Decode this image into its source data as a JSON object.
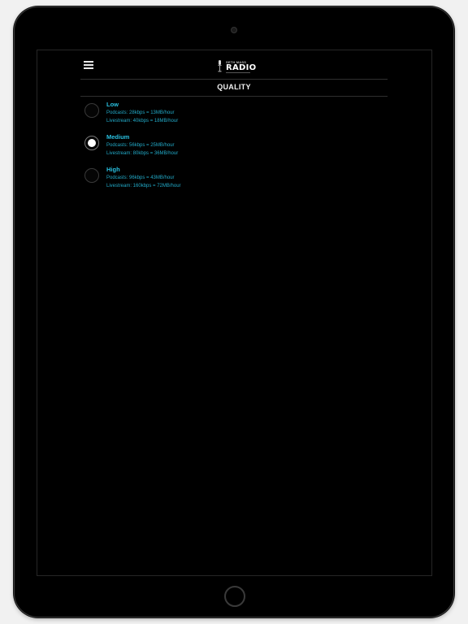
{
  "app": {
    "logo": {
      "small_text": "SETH MASS",
      "big_text": "RADIO"
    }
  },
  "header": {
    "title": "QUALITY",
    "menu_icon": "hamburger-menu-icon"
  },
  "quality_options": [
    {
      "label": "Low",
      "podcasts": "Podcasts: 28kbps = 13MB/hour",
      "livestream": "Livestream: 40kbps = 18MB/hour",
      "selected": false
    },
    {
      "label": "Medium",
      "podcasts": "Podcasts: 56kbps = 25MB/hour",
      "livestream": "Livestream: 80kbps = 36MB/hour",
      "selected": true
    },
    {
      "label": "High",
      "podcasts": "Podcasts: 96kbps = 43MB/hour",
      "livestream": "Livestream: 160kbps = 72MB/hour",
      "selected": false
    }
  ],
  "colors": {
    "accent": "#29c0e0",
    "background": "#000000",
    "title_text": "#f2f2f2"
  }
}
